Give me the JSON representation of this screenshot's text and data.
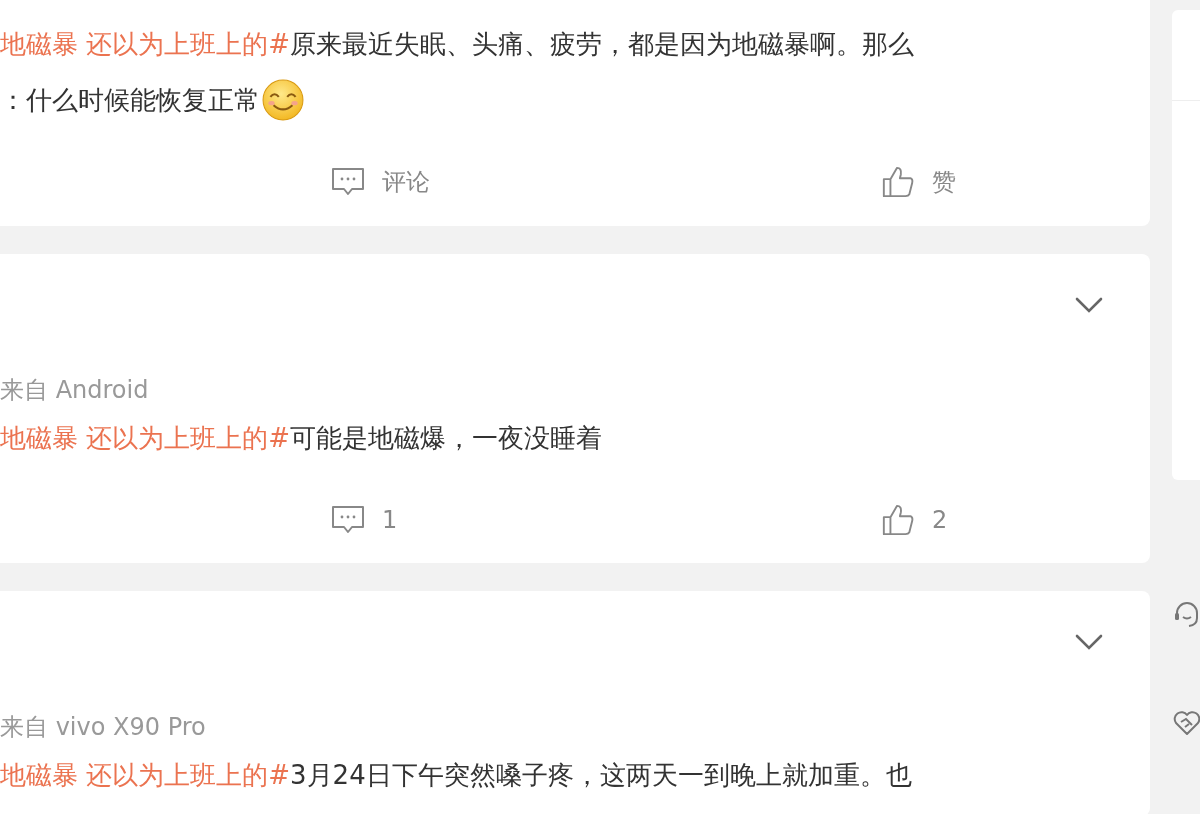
{
  "posts": [
    {
      "lines": [
        {
          "kind": "plain",
          "topic": "地磁暴 还以为上班上的#",
          "text": "原来最近失眠、头痛、疲劳，都是因为地磁暴啊。那么"
        },
        {
          "kind": "emoji",
          "text": "：什么时候能恢复正常"
        }
      ],
      "comment": "评论",
      "like": "赞",
      "menu": false
    },
    {
      "source": "来自 Android",
      "lines": [
        {
          "kind": "plain",
          "topic": "地磁暴 还以为上班上的#",
          "text": "可能是地磁爆，一夜没睡着"
        }
      ],
      "comment": "1",
      "like": "2",
      "menu": true
    },
    {
      "source": "来自 vivo X90 Pro",
      "lines": [
        {
          "kind": "plain",
          "topic": "地磁暴 还以为上班上的#",
          "text": "3月24日下午突然嗓子疼，这两天一到晚上就加重。也"
        }
      ],
      "menu": true
    }
  ],
  "side_tools": [
    {
      "kind": "support"
    },
    {
      "kind": "care"
    }
  ]
}
